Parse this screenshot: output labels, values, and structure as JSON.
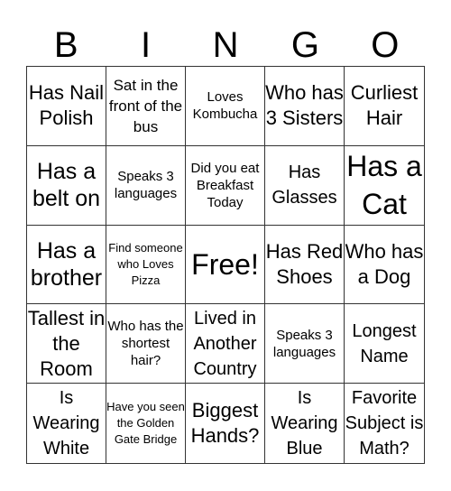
{
  "header": [
    "B",
    "I",
    "N",
    "G",
    "O"
  ],
  "cells": [
    {
      "text": "Has Nail Polish",
      "size": "s22"
    },
    {
      "text": "Sat in the front of the bus",
      "size": "s17"
    },
    {
      "text": "Loves Kombucha",
      "size": "s15"
    },
    {
      "text": "Who has 3 Sisters",
      "size": "s22"
    },
    {
      "text": "Curliest Hair",
      "size": "s22"
    },
    {
      "text": "Has a belt on",
      "size": "s24"
    },
    {
      "text": "Speaks 3 languages",
      "size": "s15"
    },
    {
      "text": "Did you eat Breakfast Today",
      "size": "s15"
    },
    {
      "text": "Has Glasses",
      "size": "s20"
    },
    {
      "text": "Has a Cat",
      "size": "s30"
    },
    {
      "text": "Has a brother",
      "size": "s24"
    },
    {
      "text": "Find someone who Loves Pizza",
      "size": "s13"
    },
    {
      "text": "Free!",
      "size": "s30"
    },
    {
      "text": "Has Red Shoes",
      "size": "s22"
    },
    {
      "text": "Who has a Dog",
      "size": "s22"
    },
    {
      "text": "Tallest in the Room",
      "size": "s22"
    },
    {
      "text": "Who has the shortest hair?",
      "size": "s15"
    },
    {
      "text": "Lived in Another Country",
      "size": "s20"
    },
    {
      "text": "Speaks 3 languages",
      "size": "s15"
    },
    {
      "text": "Longest Name",
      "size": "s20"
    },
    {
      "text": "Is Wearing White",
      "size": "s20"
    },
    {
      "text": "Have you seen the Golden Gate Bridge",
      "size": "s13"
    },
    {
      "text": "Biggest Hands?",
      "size": "s22"
    },
    {
      "text": "Is Wearing Blue",
      "size": "s20"
    },
    {
      "text": "Favorite Subject is Math?",
      "size": "s20"
    }
  ]
}
